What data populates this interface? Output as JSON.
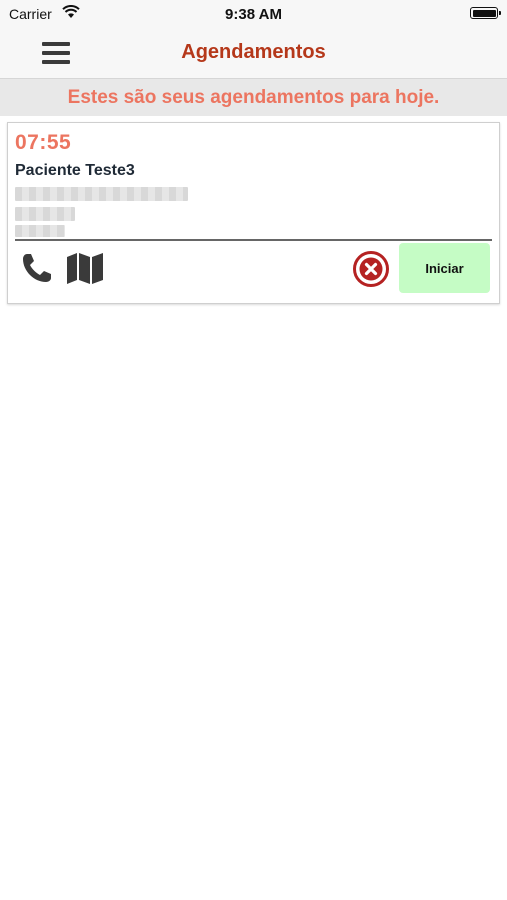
{
  "status_bar": {
    "carrier": "Carrier",
    "time": "9:38 AM",
    "wifi_icon": "wifi-icon",
    "battery_icon": "battery-icon"
  },
  "nav": {
    "title": "Agendamentos",
    "menu_icon": "hamburger-menu-icon"
  },
  "banner": {
    "message": "Estes são seus agendamentos para hoje."
  },
  "appointments": [
    {
      "time": "07:55",
      "patient": "Paciente Teste3",
      "actions": {
        "phone_icon": "phone-icon",
        "map_icon": "map-icon",
        "cancel_icon": "cancel-circle-icon",
        "start_label": "Iniciar"
      }
    }
  ],
  "colors": {
    "title": "#b5381a",
    "accent": "#ec7560",
    "start_button": "#c5fcc5",
    "cancel": "#b52222",
    "icon": "#3a3a3a"
  }
}
